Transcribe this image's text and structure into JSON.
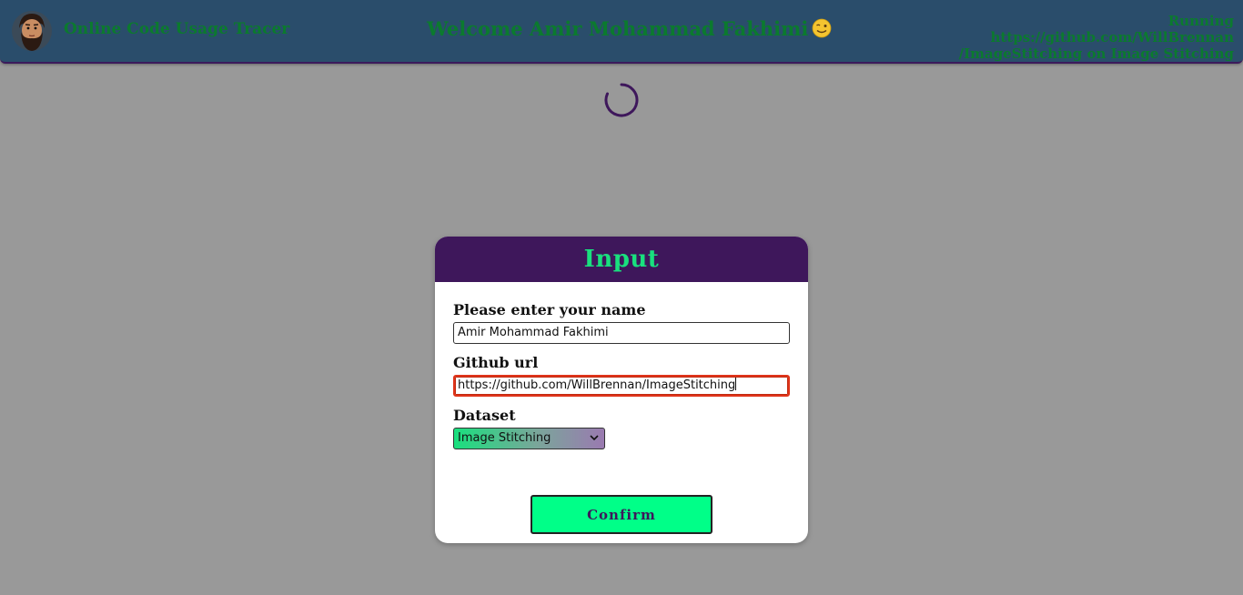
{
  "header": {
    "app_name": "Online Code Usage Tracer",
    "welcome": "Welcome Amir Mohammad Fakhimi",
    "running_line1": "Running https://github.com/WillBrennan",
    "running_line2": "/ImageStitching on Image Stitching",
    "avatar_icon": "bearded-man-avatar",
    "emoji_icon": "winking-face-icon"
  },
  "loading": {
    "icon": "spinner-icon"
  },
  "modal": {
    "title": "Input",
    "name_label": "Please enter your name",
    "name_value": "Amir Mohammad Fakhimi",
    "github_label": "Github url",
    "github_value": "https://github.com/WillBrennan/ImageStitching",
    "dataset_label": "Dataset",
    "dataset_selected": "Image Stitching",
    "confirm_label": "Confirm"
  },
  "colors": {
    "header_bg": "#2a4d6b",
    "header_text": "#0b7a2e",
    "modal_header_bg": "#3e175b",
    "accent_green": "#00ff88",
    "page_bg": "#999999"
  }
}
